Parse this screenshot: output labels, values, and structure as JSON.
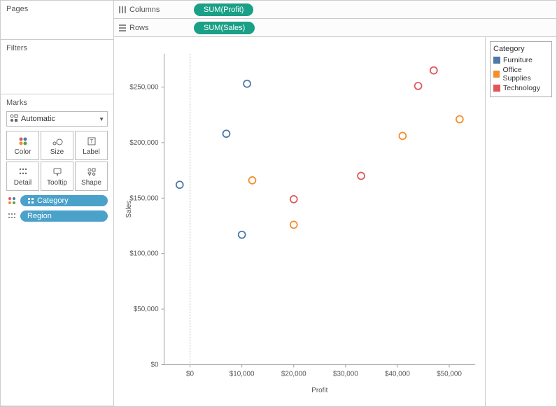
{
  "panels": {
    "pages_title": "Pages",
    "filters_title": "Filters",
    "marks_title": "Marks",
    "mark_type": "Automatic",
    "mark_cells": [
      "Color",
      "Size",
      "Label",
      "Detail",
      "Tooltip",
      "Shape"
    ],
    "pill_category": "Category",
    "pill_region": "Region"
  },
  "shelves": {
    "columns_label": "Columns",
    "rows_label": "Rows",
    "columns_pill": "SUM(Profit)",
    "rows_pill": "SUM(Sales)"
  },
  "legend": {
    "title": "Category",
    "items": [
      {
        "label": "Furniture",
        "color": "#4e79a7"
      },
      {
        "label": "Office Supplies",
        "color": "#f28e2b"
      },
      {
        "label": "Technology",
        "color": "#e15759"
      }
    ]
  },
  "axes": {
    "x_label": "Profit",
    "y_label": "Sales",
    "x_ticks": [
      "$0",
      "$10,000",
      "$20,000",
      "$30,000",
      "$40,000",
      "$50,000"
    ],
    "y_ticks": [
      "$0",
      "$50,000",
      "$100,000",
      "$150,000",
      "$200,000",
      "$250,000"
    ]
  },
  "chart_data": {
    "type": "scatter",
    "xlabel": "Profit",
    "ylabel": "Sales",
    "xlim": [
      -5000,
      55000
    ],
    "ylim": [
      0,
      280000
    ],
    "series": [
      {
        "name": "Furniture",
        "color": "#4e79a7",
        "points": [
          {
            "x": -2000,
            "y": 162000
          },
          {
            "x": 7000,
            "y": 208000
          },
          {
            "x": 10000,
            "y": 117000
          },
          {
            "x": 11000,
            "y": 253000
          }
        ]
      },
      {
        "name": "Office Supplies",
        "color": "#f28e2b",
        "points": [
          {
            "x": 12000,
            "y": 166000
          },
          {
            "x": 20000,
            "y": 126000
          },
          {
            "x": 41000,
            "y": 206000
          },
          {
            "x": 52000,
            "y": 221000
          }
        ]
      },
      {
        "name": "Technology",
        "color": "#e15759",
        "points": [
          {
            "x": 20000,
            "y": 149000
          },
          {
            "x": 33000,
            "y": 170000
          },
          {
            "x": 44000,
            "y": 251000
          },
          {
            "x": 47000,
            "y": 265000
          }
        ]
      }
    ]
  }
}
